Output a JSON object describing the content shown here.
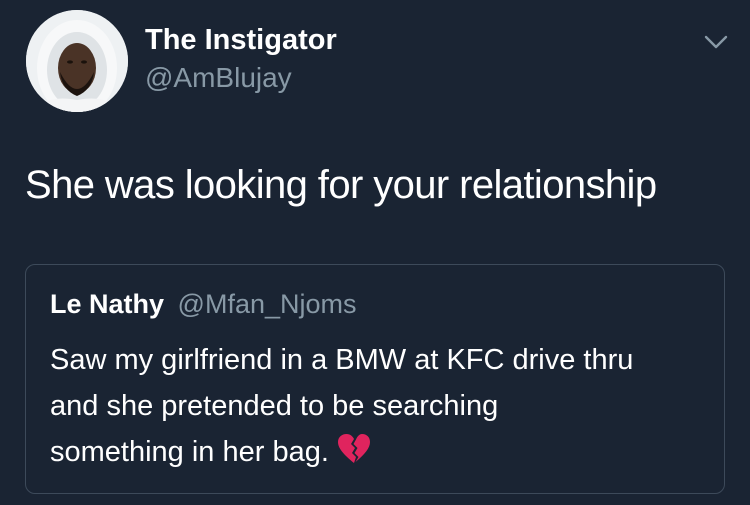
{
  "author": {
    "name": "The Instigator",
    "handle": "@AmBlujay",
    "avatar_icon": "profile-photo-hooded-man"
  },
  "menu": {
    "icon": "chevron-down-icon"
  },
  "tweet": {
    "text": "She was looking for your relationship"
  },
  "quoted_tweet": {
    "name": "Le Nathy",
    "handle": "@Mfan_Njoms",
    "lines": [
      "Saw my girlfriend in a BMW at KFC drive thru",
      "and she pretended to be searching",
      "something in her bag."
    ],
    "emoji_icon": "broken-heart-icon"
  },
  "colors": {
    "background": "#1a2433",
    "primary_text": "#ffffff",
    "secondary_text": "#8899a6",
    "card_border": "#3d4a5a",
    "broken_heart": "#e0245e"
  }
}
